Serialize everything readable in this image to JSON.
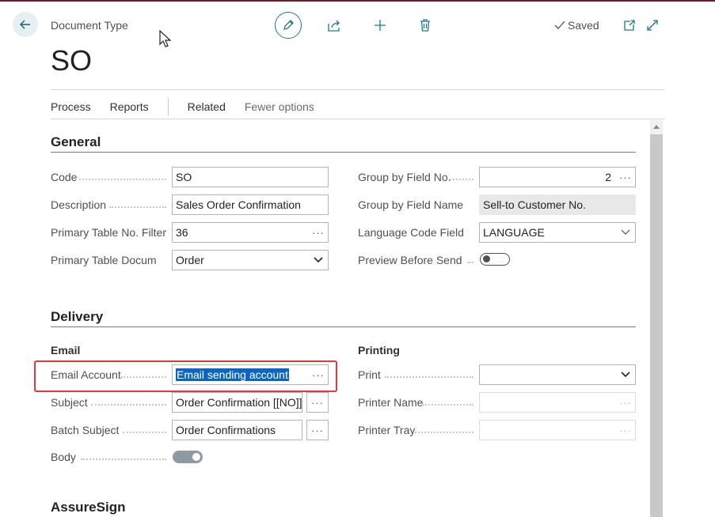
{
  "header": {
    "caption": "Document Type",
    "title": "SO",
    "saved_label": "Saved"
  },
  "actions": {
    "process": "Process",
    "reports": "Reports",
    "related": "Related",
    "fewer_options": "Fewer options"
  },
  "general": {
    "title": "General",
    "code_label": "Code",
    "code_value": "SO",
    "description_label": "Description",
    "description_value": "Sales Order Confirmation",
    "primary_table_label": "Primary Table No. Filter",
    "primary_table_value": "36",
    "primary_doc_label": "Primary Table Docum...",
    "primary_doc_value": "Order",
    "group_field_no_label": "Group by Field No.",
    "group_field_no_value": "2",
    "group_field_name_label": "Group by Field Name",
    "group_field_name_value": "Sell-to Customer No.",
    "language_label": "Language Code Field",
    "language_value": "LANGUAGE",
    "preview_label": "Preview Before Sendi..."
  },
  "delivery": {
    "title": "Delivery",
    "email_heading": "Email",
    "printing_heading": "Printing",
    "email_account_label": "Email Account",
    "email_account_value": "Email sending account",
    "subject_label": "Subject",
    "subject_value": "Order Confirmation [[NO]]",
    "batch_subject_label": "Batch Subject",
    "batch_subject_value": "Order Confirmations",
    "body_label": "Body",
    "print_label": "Print",
    "print_value": "",
    "printer_name_label": "Printer Name",
    "printer_name_value": "",
    "printer_tray_label": "Printer Tray",
    "printer_tray_value": ""
  },
  "assuresign": {
    "title": "AssureSign"
  },
  "ellipsis": "···",
  "colors": {
    "accent": "#1f7a8c",
    "highlight_border": "#e0393e",
    "selection": "#0b65c9"
  }
}
